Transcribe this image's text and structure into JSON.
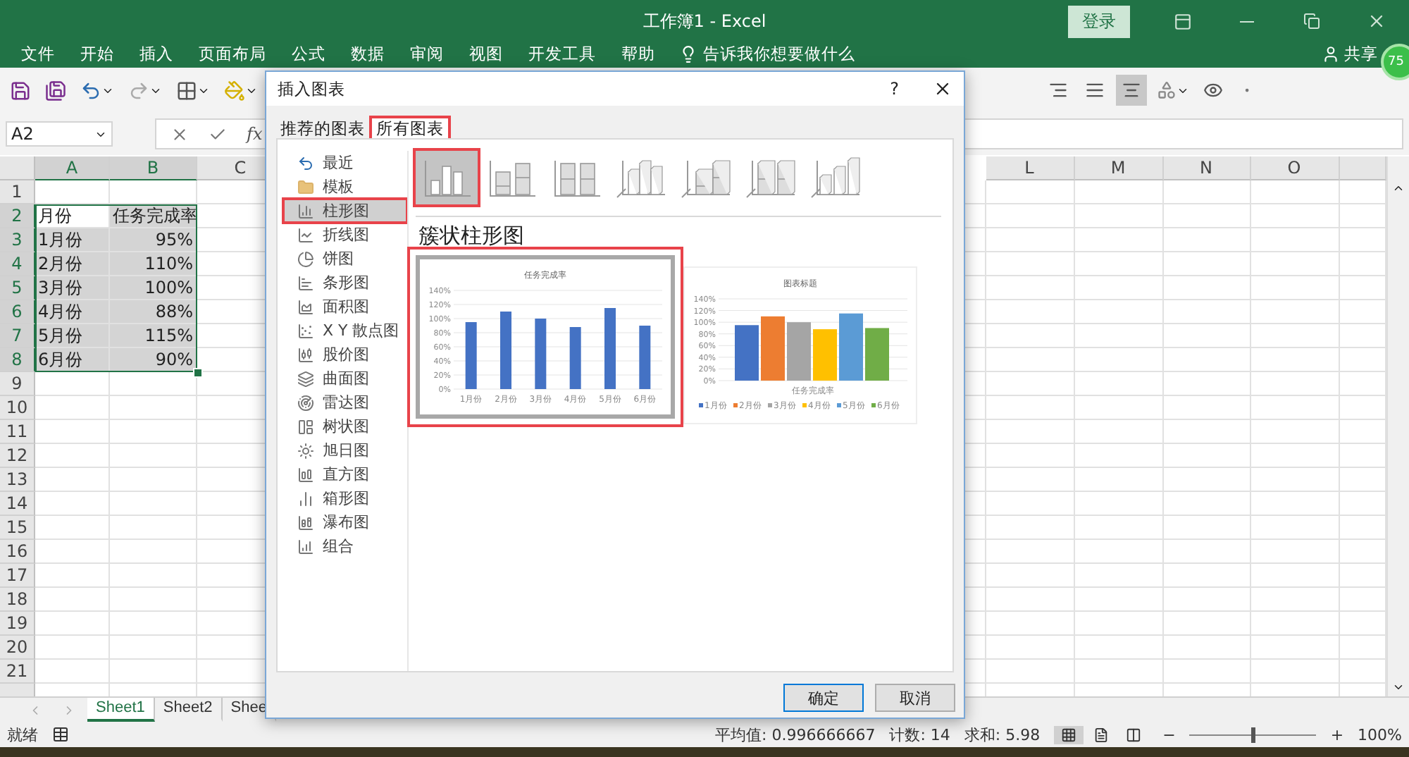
{
  "window": {
    "title": "工作簿1  -  Excel",
    "sign_in": "登录",
    "badge": "75"
  },
  "ribbon": {
    "tabs": [
      {
        "label": "文件"
      },
      {
        "label": "开始"
      },
      {
        "label": "插入"
      },
      {
        "label": "页面布局"
      },
      {
        "label": "公式"
      },
      {
        "label": "数据"
      },
      {
        "label": "审阅"
      },
      {
        "label": "视图"
      },
      {
        "label": "开发工具"
      },
      {
        "label": "帮助"
      }
    ],
    "tell_me": "告诉我你想要做什么",
    "share": "共享"
  },
  "toolbar": {
    "align_buttons": [
      {
        "selected": false
      },
      {
        "selected": false
      },
      {
        "selected": true
      }
    ]
  },
  "formula_bar": {
    "name_box": "A2",
    "function_label": "fx"
  },
  "sheet": {
    "columns_left": [
      {
        "label": "A",
        "highlighted": true
      },
      {
        "label": "B",
        "highlighted": true
      },
      {
        "label": "C",
        "highlighted": false
      }
    ],
    "columns_right": [
      {
        "label": "L",
        "highlighted": false
      },
      {
        "label": "M",
        "highlighted": false
      },
      {
        "label": "N",
        "highlighted": false
      },
      {
        "label": "O",
        "highlighted": false
      }
    ],
    "rows": [
      {
        "number": "1",
        "highlighted": false
      },
      {
        "number": "2",
        "highlighted": true,
        "cells": [
          {
            "text": "月份",
            "kind": "text",
            "highlighted": false
          },
          {
            "text": "任务完成率",
            "kind": "text",
            "highlighted": true
          }
        ]
      },
      {
        "number": "3",
        "highlighted": true,
        "cells": [
          {
            "text": "1月份",
            "kind": "text",
            "highlighted": true
          },
          {
            "text": "95%",
            "kind": "number",
            "highlighted": true
          }
        ]
      },
      {
        "number": "4",
        "highlighted": true,
        "cells": [
          {
            "text": "2月份",
            "kind": "text",
            "highlighted": true
          },
          {
            "text": "110%",
            "kind": "number",
            "highlighted": true
          }
        ]
      },
      {
        "number": "5",
        "highlighted": true,
        "cells": [
          {
            "text": "3月份",
            "kind": "text",
            "highlighted": true
          },
          {
            "text": "100%",
            "kind": "number",
            "highlighted": true
          }
        ]
      },
      {
        "number": "6",
        "highlighted": true,
        "cells": [
          {
            "text": "4月份",
            "kind": "text",
            "highlighted": true
          },
          {
            "text": "88%",
            "kind": "number",
            "highlighted": true
          }
        ]
      },
      {
        "number": "7",
        "highlighted": true,
        "cells": [
          {
            "text": "5月份",
            "kind": "text",
            "highlighted": true
          },
          {
            "text": "115%",
            "kind": "number",
            "highlighted": true
          }
        ]
      },
      {
        "number": "8",
        "highlighted": true,
        "cells": [
          {
            "text": "6月份",
            "kind": "text",
            "highlighted": true
          },
          {
            "text": "90%",
            "kind": "number",
            "highlighted": true
          }
        ]
      },
      {
        "number": "9",
        "highlighted": false
      },
      {
        "number": "10",
        "highlighted": false
      },
      {
        "number": "11",
        "highlighted": false
      },
      {
        "number": "12",
        "highlighted": false
      },
      {
        "number": "13",
        "highlighted": false
      },
      {
        "number": "14",
        "highlighted": false
      },
      {
        "number": "15",
        "highlighted": false
      },
      {
        "number": "16",
        "highlighted": false
      },
      {
        "number": "17",
        "highlighted": false
      },
      {
        "number": "18",
        "highlighted": false
      },
      {
        "number": "19",
        "highlighted": false
      },
      {
        "number": "20",
        "highlighted": false
      },
      {
        "number": "21",
        "highlighted": false
      }
    ]
  },
  "sheet_tabs": [
    {
      "label": "Sheet1",
      "selected": true
    },
    {
      "label": "Sheet2",
      "selected": false
    },
    {
      "label": "Shee",
      "selected": false
    }
  ],
  "status_bar": {
    "status": "就绪",
    "average": "平均值: 0.996666667",
    "count": "计数: 14",
    "sum": "求和: 5.98",
    "views": [
      {
        "selected": true
      },
      {
        "selected": false
      },
      {
        "selected": false
      }
    ],
    "zoom": {
      "minus": "−",
      "plus": "+",
      "level": 0.5,
      "reading": "100%"
    }
  },
  "dialog": {
    "title": "插入图表",
    "help": "?",
    "tabs": [
      {
        "label": "推荐的图表",
        "selected": false
      },
      {
        "label": "所有图表",
        "selected": true
      }
    ],
    "chart_types": [
      {
        "label": "最近",
        "selected": false
      },
      {
        "label": "模板",
        "selected": false
      },
      {
        "label": "柱形图",
        "selected": true
      },
      {
        "label": "折线图",
        "selected": false
      },
      {
        "label": "饼图",
        "selected": false
      },
      {
        "label": "条形图",
        "selected": false
      },
      {
        "label": "面积图",
        "selected": false
      },
      {
        "label": "X Y 散点图",
        "selected": false
      },
      {
        "label": "股价图",
        "selected": false
      },
      {
        "label": "曲面图",
        "selected": false
      },
      {
        "label": "雷达图",
        "selected": false
      },
      {
        "label": "树状图",
        "selected": false
      },
      {
        "label": "旭日图",
        "selected": false
      },
      {
        "label": "直方图",
        "selected": false
      },
      {
        "label": "箱形图",
        "selected": false
      },
      {
        "label": "瀑布图",
        "selected": false
      },
      {
        "label": "组合",
        "selected": false
      }
    ],
    "subtypes": [
      {
        "selected": true
      },
      {
        "selected": false
      },
      {
        "selected": false
      },
      {
        "selected": false
      },
      {
        "selected": false
      },
      {
        "selected": false
      },
      {
        "selected": false
      }
    ],
    "subtype_title": "簇状柱形图",
    "previews": [
      {
        "selected": true,
        "chart_data": {
          "type": "bar",
          "title": "任务完成率",
          "categories": [
            "1月份",
            "2月份",
            "3月份",
            "4月份",
            "5月份",
            "6月份"
          ],
          "series": [
            {
              "color": "#4472c4",
              "values": [
                0.95,
                1.1,
                1.0,
                0.88,
                1.15,
                0.9
              ]
            }
          ],
          "grid": true,
          "ylim": [
            0,
            1.4
          ],
          "yticks": [
            {
              "value": 0,
              "label": "0%"
            },
            {
              "value": 0.2,
              "label": "20%"
            },
            {
              "value": 0.4,
              "label": "40%"
            },
            {
              "value": 0.6,
              "label": "60%"
            },
            {
              "value": 0.8,
              "label": "80%"
            },
            {
              "value": 1.0,
              "label": "100%"
            },
            {
              "value": 1.2,
              "label": "120%"
            },
            {
              "value": 1.4,
              "label": "140%"
            }
          ]
        }
      },
      {
        "selected": false,
        "chart_data": {
          "type": "bar",
          "title": "图表标题",
          "categories": [
            "任务完成率"
          ],
          "series": [
            {
              "name": "1月份",
              "color": "#4472c4",
              "values": [
                0.95
              ]
            },
            {
              "name": "2月份",
              "color": "#ed7d31",
              "values": [
                1.1
              ]
            },
            {
              "name": "3月份",
              "color": "#a5a5a5",
              "values": [
                1.0
              ]
            },
            {
              "name": "4月份",
              "color": "#ffc000",
              "values": [
                0.88
              ]
            },
            {
              "name": "5月份",
              "color": "#5b9bd5",
              "values": [
                1.15
              ]
            },
            {
              "name": "6月份",
              "color": "#70ad47",
              "values": [
                0.9
              ]
            }
          ],
          "grid": true,
          "legend": "bottom",
          "ylim": [
            0,
            1.4
          ],
          "yticks": [
            {
              "value": 0,
              "label": "0%"
            },
            {
              "value": 0.2,
              "label": "20%"
            },
            {
              "value": 0.4,
              "label": "40%"
            },
            {
              "value": 0.6,
              "label": "60%"
            },
            {
              "value": 0.8,
              "label": "80%"
            },
            {
              "value": 1.0,
              "label": "100%"
            },
            {
              "value": 1.2,
              "label": "120%"
            },
            {
              "value": 1.4,
              "label": "140%"
            }
          ]
        }
      }
    ],
    "buttons": [
      {
        "label": "确定",
        "default": true
      },
      {
        "label": "取消",
        "default": false
      }
    ]
  }
}
